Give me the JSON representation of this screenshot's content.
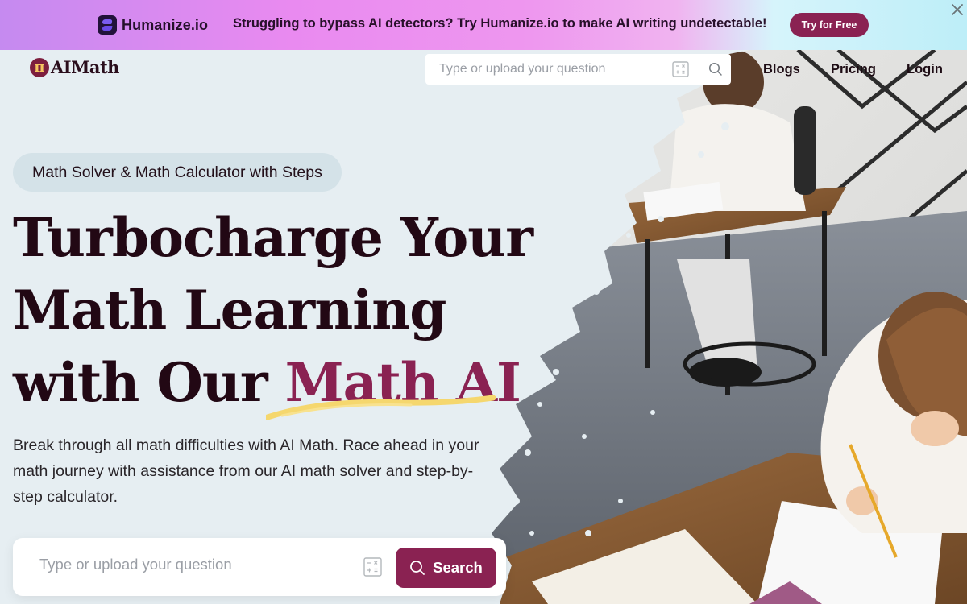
{
  "promo": {
    "brand": "Humanize.io",
    "message": "Struggling to bypass AI detectors? Try Humanize.io to make AI writing undetectable!",
    "cta_label": "Try for Free",
    "close_icon": "close-icon"
  },
  "header": {
    "logo_text": "AIMath",
    "logo_glyph": "π",
    "search": {
      "placeholder": "Type or upload your question",
      "value": ""
    },
    "nav": [
      {
        "label": "Blogs"
      },
      {
        "label": "Pricing"
      },
      {
        "label": "Login"
      }
    ]
  },
  "hero": {
    "tagline": "Math Solver & Math Calculator with Steps",
    "headline_line1": "Turbocharge Your",
    "headline_line2": "Math Learning",
    "headline_line3_prefix": "with Our ",
    "headline_line3_accent": "Math AI",
    "description": "Break through all math difficulties with AI Math. Race ahead in your math journey with assistance from our AI math solver and step-by-step calculator.",
    "search": {
      "placeholder": "Type or upload your question",
      "value": "",
      "button_label": "Search"
    }
  },
  "colors": {
    "brand": "#8a2252",
    "headline": "#220814",
    "background": "#e6eef2",
    "pill_bg": "#d4e2e8",
    "underline": "#f5d76e"
  }
}
